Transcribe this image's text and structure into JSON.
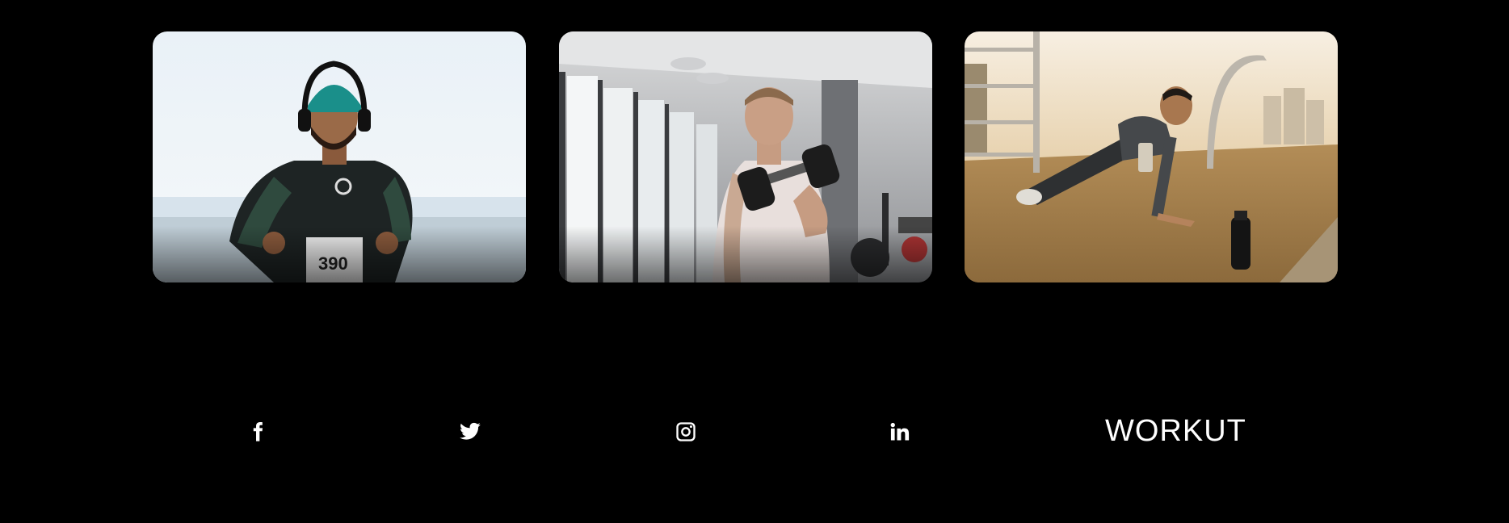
{
  "gallery": {
    "cards": [
      {
        "icon": "runner-with-headphones-photo"
      },
      {
        "icon": "dumbbell-curl-gym-photo"
      },
      {
        "icon": "outdoor-pushup-photo"
      }
    ]
  },
  "footer": {
    "social": [
      {
        "icon": "facebook-icon"
      },
      {
        "icon": "twitter-icon"
      },
      {
        "icon": "instagram-icon"
      },
      {
        "icon": "linkedin-icon"
      }
    ],
    "brand": "WORKUT"
  },
  "colors": {
    "background": "#000000",
    "text": "#ffffff"
  }
}
